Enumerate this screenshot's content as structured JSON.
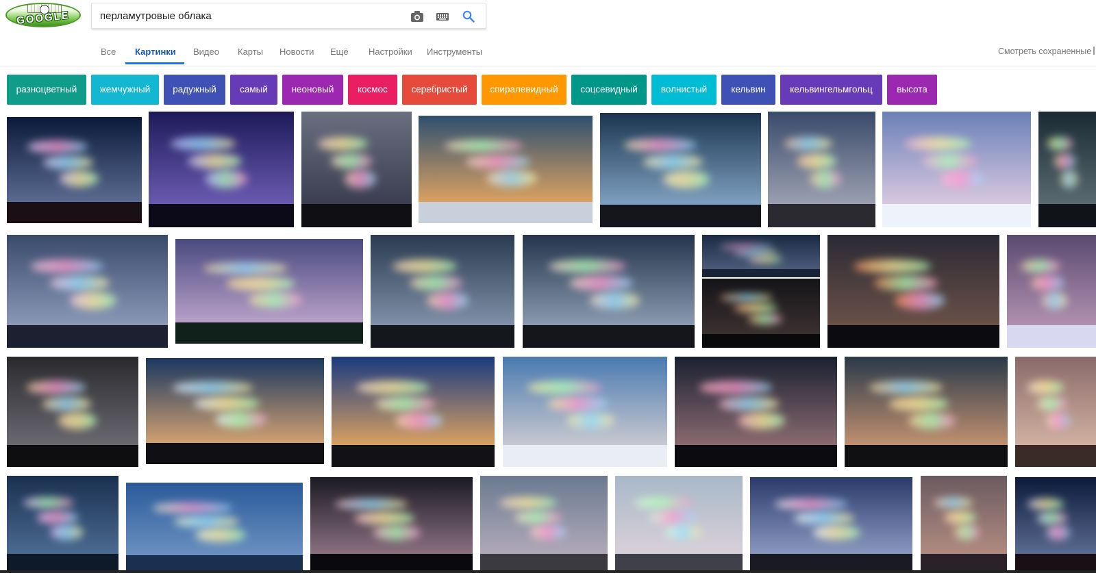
{
  "header": {
    "logo_text": "GOOGLE",
    "search": {
      "value": "перламутровые облака",
      "placeholder": ""
    },
    "icons": [
      "camera-icon",
      "keyboard-icon",
      "search-icon"
    ],
    "accent": "#1a73e8"
  },
  "tabs": [
    {
      "label": "Все",
      "active": false
    },
    {
      "label": "Картинки",
      "active": true
    },
    {
      "label": "Видео",
      "active": false
    },
    {
      "label": "Карты",
      "active": false
    },
    {
      "label": "Новости",
      "active": false
    },
    {
      "label": "Ещё",
      "active": false
    },
    {
      "label": "Настройки",
      "active": false
    },
    {
      "label": "Инструменты",
      "active": false
    }
  ],
  "saved_label": "Смотреть сохраненные",
  "chips": [
    {
      "label": "разноцветный",
      "color": "#0f9d8a"
    },
    {
      "label": "жемчужный",
      "color": "#13b7d1"
    },
    {
      "label": "радужный",
      "color": "#3f51b5"
    },
    {
      "label": "самый",
      "color": "#673ab7"
    },
    {
      "label": "неоновый",
      "color": "#9c27b0"
    },
    {
      "label": "космос",
      "color": "#e91e63"
    },
    {
      "label": "серебристый",
      "color": "#e64a3b"
    },
    {
      "label": "спиралевидный",
      "color": "#ff9800"
    },
    {
      "label": "соцсевидный",
      "color": "#009688"
    },
    {
      "label": "волнистый",
      "color": "#00bcd4"
    },
    {
      "label": "кельвин",
      "color": "#3f51b5"
    },
    {
      "label": "кельвингельмгольц",
      "color": "#673ab7"
    },
    {
      "label": "высота",
      "color": "#9c27b0"
    }
  ],
  "results": {
    "thumbnails": [
      {
        "name": "image-result-1",
        "sky_top": "#0b1a3a",
        "sky_bottom": "#5a6a90",
        "ground": "#1a0f14",
        "glow": "#e9d6ff"
      },
      {
        "name": "image-result-2",
        "sky_top": "#1e1a5a",
        "sky_bottom": "#6a5ab0",
        "ground": "#0c0a18",
        "glow": "#c9c6ff"
      },
      {
        "name": "image-result-3",
        "sky_top": "#6a6f80",
        "sky_bottom": "#3a3e50",
        "ground": "#101014",
        "glow": "#ffd8c0"
      },
      {
        "name": "image-result-4",
        "sky_top": "#2e5070",
        "sky_bottom": "#d9a060",
        "ground": "#c8d0dc",
        "glow": "#ffe0c8"
      },
      {
        "name": "image-result-5",
        "sky_top": "#1b3550",
        "sky_bottom": "#7fa0c0",
        "ground": "#15151c",
        "glow": "#ffeebb"
      },
      {
        "name": "image-result-6",
        "sky_top": "#3a4a6a",
        "sky_bottom": "#9aa0b0",
        "ground": "#2a2a30",
        "glow": "#ffc8a8"
      },
      {
        "name": "image-result-7",
        "sky_top": "#6a80b8",
        "sky_bottom": "#d8c8e0",
        "ground": "#eef2fa",
        "glow": "#ffb8d8"
      },
      {
        "name": "image-result-8",
        "sky_top": "#1a2a34",
        "sky_bottom": "#5a6a70",
        "ground": "#101418",
        "glow": "#ffe8a0"
      },
      {
        "name": "image-result-9",
        "sky_top": "#3a4a6a",
        "sky_bottom": "#8a98b8",
        "ground": "#1c2030",
        "glow": "#ffd0e8"
      },
      {
        "name": "image-result-10",
        "sky_top": "#4a4a80",
        "sky_bottom": "#b8a0c8",
        "ground": "#10201a",
        "glow": "#ffe0a0"
      },
      {
        "name": "image-result-11",
        "sky_top": "#2a3a50",
        "sky_bottom": "#8090a8",
        "ground": "#14181c",
        "glow": "#ffd8b8"
      },
      {
        "name": "image-result-12",
        "sky_top": "#24344c",
        "sky_bottom": "#8a9ab0",
        "ground": "#14161c",
        "glow": "#ffe0d0"
      },
      {
        "name": "image-result-13",
        "sky_top": "#1a2a44",
        "sky_bottom": "#4a5a78",
        "ground": "#1a2438",
        "glow": "#ffc8e0"
      },
      {
        "name": "image-result-14",
        "sky_top": "#141418",
        "sky_bottom": "#3a3030",
        "ground": "#0a0a0c",
        "glow": "#ffb080"
      },
      {
        "name": "image-result-15",
        "sky_top": "#2a2a34",
        "sky_bottom": "#6a5048",
        "ground": "#0c0c10",
        "glow": "#ff9a60"
      },
      {
        "name": "image-result-16",
        "sky_top": "#5a4a70",
        "sky_bottom": "#b090b0",
        "ground": "#d8d8f0",
        "glow": "#ffd0a8"
      },
      {
        "name": "image-result-17",
        "sky_top": "#2a2a2e",
        "sky_bottom": "#6a6870",
        "ground": "#0e0e10",
        "glow": "#ffe0b0"
      },
      {
        "name": "image-result-18",
        "sky_top": "#1a3860",
        "sky_bottom": "#d0a070",
        "ground": "#101014",
        "glow": "#f0f8ff"
      },
      {
        "name": "image-result-19",
        "sky_top": "#1a3a80",
        "sky_bottom": "#d8a060",
        "ground": "#121216",
        "glow": "#ffe0c0"
      },
      {
        "name": "image-result-20",
        "sky_top": "#4a7ab0",
        "sky_bottom": "#c8c8d0",
        "ground": "#e8eef4",
        "glow": "#fff0a0"
      },
      {
        "name": "image-result-21",
        "sky_top": "#1a2030",
        "sky_bottom": "#8a6a70",
        "ground": "#0c0c10",
        "glow": "#ffb8c8"
      },
      {
        "name": "image-result-22",
        "sky_top": "#2a3a4a",
        "sky_bottom": "#c09070",
        "ground": "#101012",
        "glow": "#ffd8a0"
      },
      {
        "name": "image-result-23",
        "sky_top": "#8a6a6a",
        "sky_bottom": "#d0b0a0",
        "ground": "#3a2a28",
        "glow": "#ffe8d0"
      },
      {
        "name": "image-result-24",
        "sky_top": "#1a3050",
        "sky_bottom": "#4a6a90",
        "ground": "#0e1a2a",
        "glow": "#f8c8ff"
      },
      {
        "name": "image-result-25",
        "sky_top": "#2a5a9a",
        "sky_bottom": "#6a90c0",
        "ground": "#1a3050",
        "glow": "#ffffd0"
      },
      {
        "name": "image-result-26",
        "sky_top": "#1a1a22",
        "sky_bottom": "#8a7080",
        "ground": "#0a0a0e",
        "glow": "#ffc8d8"
      },
      {
        "name": "image-result-27",
        "sky_top": "#6a7a90",
        "sky_bottom": "#b0a8b8",
        "ground": "#3a3a40",
        "glow": "#ffe0c8"
      },
      {
        "name": "image-result-28",
        "sky_top": "#a8b8c8",
        "sky_bottom": "#d8d0d8",
        "ground": "#40404a",
        "glow": "#e0ffd8"
      },
      {
        "name": "image-result-29",
        "sky_top": "#2a3a6a",
        "sky_bottom": "#8a98c0",
        "ground": "#1a1a24",
        "glow": "#ffffff"
      },
      {
        "name": "image-result-30",
        "sky_top": "#6a5a60",
        "sky_bottom": "#b08a80",
        "ground": "#2a2228",
        "glow": "#ffd0b0"
      }
    ]
  }
}
